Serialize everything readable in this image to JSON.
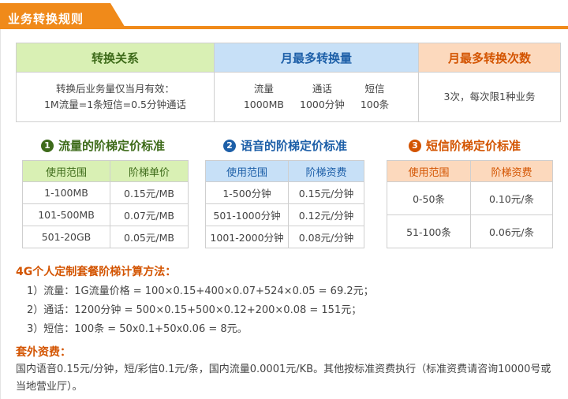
{
  "header": {
    "title": "业务转换规则"
  },
  "conversion_table": {
    "headers": [
      "转换关系",
      "月最多转换量",
      "月最多转换次数"
    ],
    "relation_lines": [
      "转换后业务量仅当月有效：",
      "1M流量=1条短信=0.5分钟通话"
    ],
    "max_volume": [
      {
        "label": "流量",
        "value": "1000MB"
      },
      {
        "label": "通话",
        "value": "1000分钟"
      },
      {
        "label": "短信",
        "value": "100条"
      }
    ],
    "max_times": "3次，每次限1种业务"
  },
  "sections": {
    "data": {
      "num": "1",
      "title": "流量的阶梯定价标准"
    },
    "voice": {
      "num": "2",
      "title": "语音的阶梯定价标准"
    },
    "sms": {
      "num": "3",
      "title": "短信阶梯定价标准"
    }
  },
  "data_table": {
    "headers": [
      "使用范围",
      "阶梯单价"
    ],
    "rows": [
      [
        "1-100MB",
        "0.15元/MB"
      ],
      [
        "101-500MB",
        "0.07元/MB"
      ],
      [
        "501-20GB",
        "0.05元/MB"
      ]
    ]
  },
  "voice_table": {
    "headers": [
      "使用范围",
      "阶梯资费"
    ],
    "rows": [
      [
        "1-500分钟",
        "0.15元/分钟"
      ],
      [
        "501-1000分钟",
        "0.12元/分钟"
      ],
      [
        "1001-2000分钟",
        "0.08元/分钟"
      ]
    ]
  },
  "sms_table": {
    "headers": [
      "使用范围",
      "阶梯资费"
    ],
    "rows": [
      [
        "0-50条",
        "0.10元/条"
      ],
      [
        "51-100条",
        "0.06元/条"
      ]
    ]
  },
  "calculation": {
    "title": "4G个人定制套餐阶梯计算方法：",
    "lines": [
      "1）流量：1G流量价格 = 100×0.15+400×0.07+524×0.05 = 69.2元；",
      "2）通话：1200分钟 = 500×0.15+500×0.12+200×0.08 = 151元；",
      "3）短信：100条 = 50x0.1+50x0.06 = 8元。"
    ]
  },
  "extra": {
    "title": "套外资费：",
    "text": "国内语音0.15元/分钟，短/彩信0.1元/条，国内流量0.0001元/KB。其他按标准资费执行（标准资费请咨询10000号或当地营业厅）。"
  },
  "colors": {
    "accent_orange": "#f08a1a",
    "green": "#3e6b1a",
    "blue": "#1d5fa8",
    "orange_text": "#d35400"
  }
}
